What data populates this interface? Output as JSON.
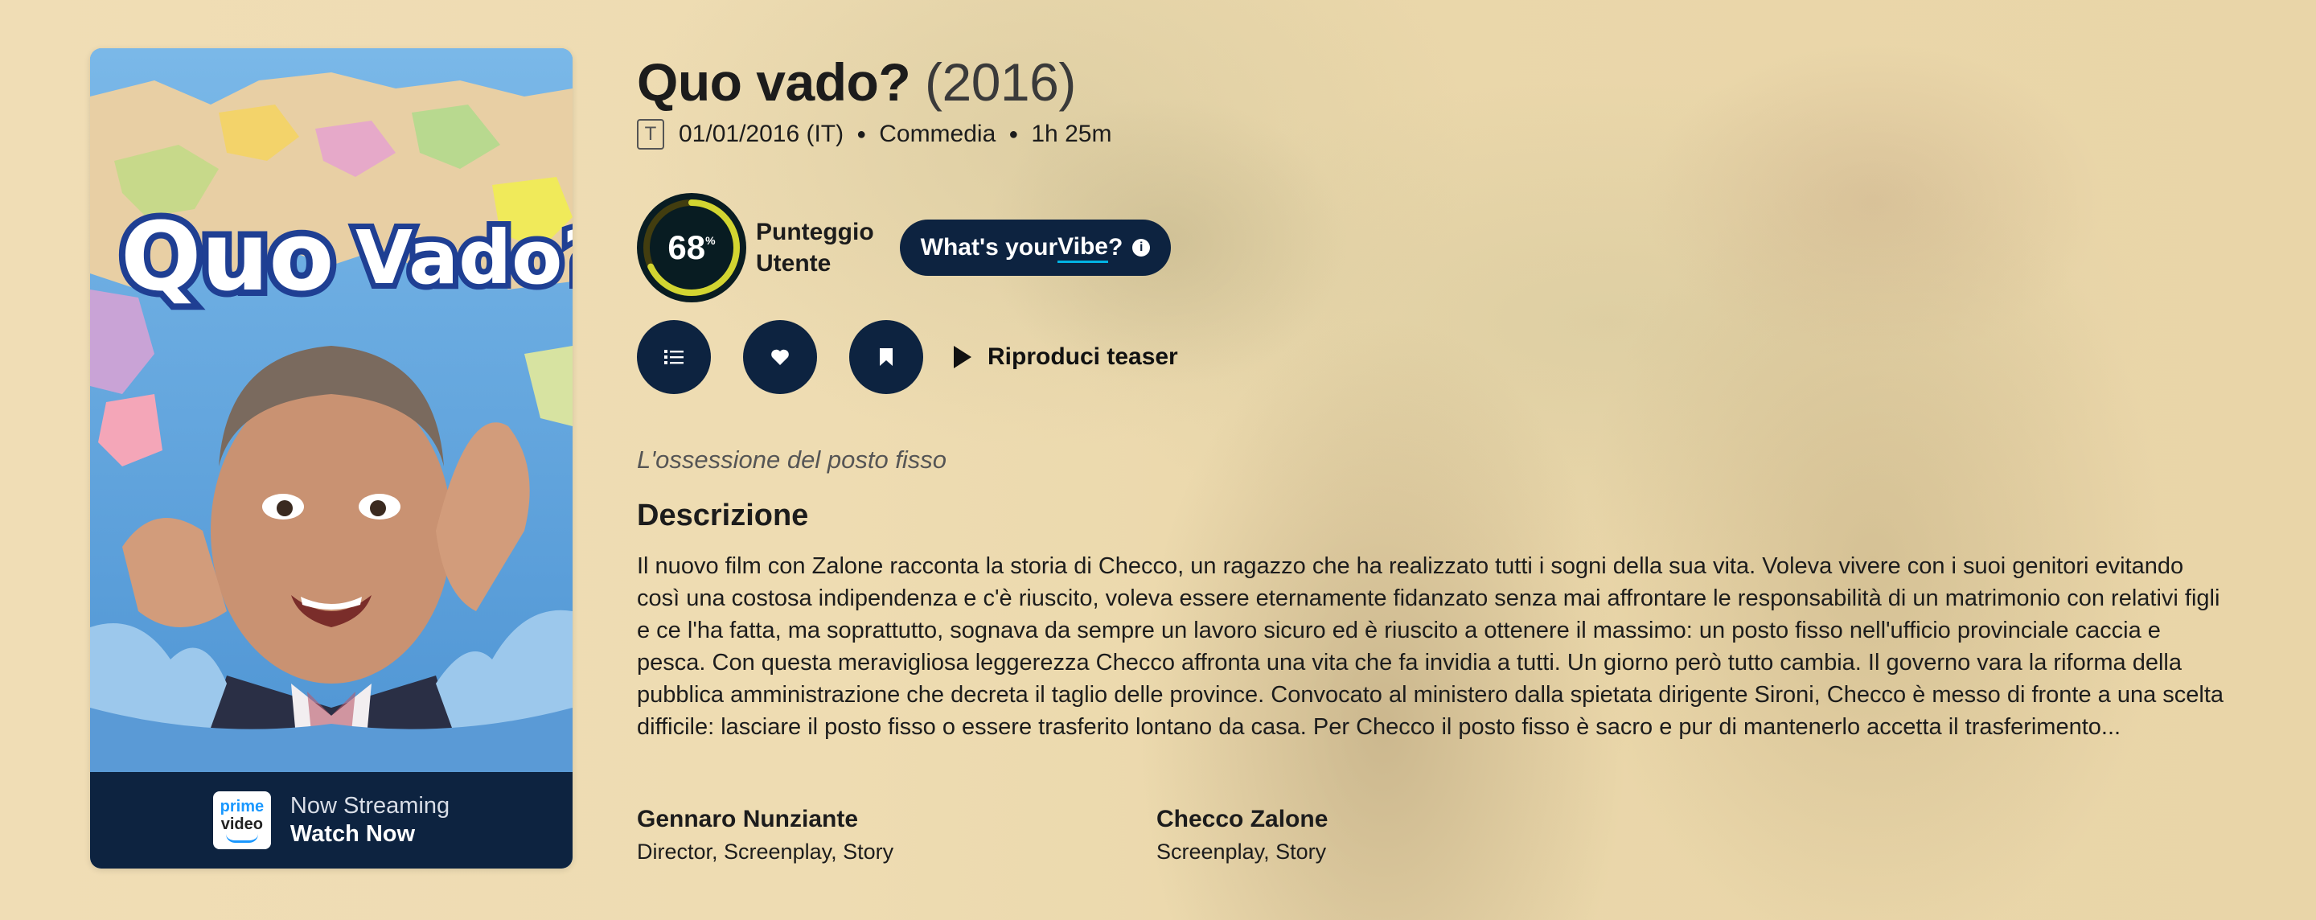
{
  "poster": {
    "title_art": "Quo Vado?",
    "provider": {
      "logo_top": "prime",
      "logo_bottom": "video",
      "line1": "Now Streaming",
      "line2": "Watch Now"
    }
  },
  "header": {
    "title": "Quo vado?",
    "year": "(2016)"
  },
  "facts": {
    "certification": "T",
    "release": "01/01/2016 (IT)",
    "genre": "Commedia",
    "runtime": "1h 25m"
  },
  "score": {
    "value": 68,
    "display": "68",
    "unit": "%",
    "label_line1": "Punteggio",
    "label_line2": "Utente",
    "ring_color": "#d2d531"
  },
  "vibe": {
    "text_before": "What's your ",
    "text_link": "Vibe",
    "text_after": "?",
    "icon": "info-icon"
  },
  "actions": {
    "list_icon": "list-icon",
    "favorite_icon": "heart-icon",
    "watchlist_icon": "bookmark-icon",
    "teaser_label": "Riproduci teaser"
  },
  "tagline": "L'ossessione del posto fisso",
  "description": {
    "heading": "Descrizione",
    "text": "Il nuovo film con Zalone racconta la storia di Checco, un ragazzo che ha realizzato tutti i sogni della sua vita. Voleva vivere con i suoi genitori evitando così una costosa indipendenza e c'è riuscito, voleva essere eternamente fidanzato senza mai affrontare le responsabilità di un matrimonio con relativi figli e ce l'ha fatta, ma soprattutto, sognava da sempre un lavoro sicuro ed è riuscito a ottenere il massimo: un posto fisso nell'ufficio provinciale caccia e pesca. Con questa meravigliosa leggerezza Checco affronta una vita che fa invidia a tutti. Un giorno però tutto cambia. Il governo vara la riforma della pubblica amministrazione che decreta il taglio delle province. Convocato al ministero dalla spietata dirigente Sironi, Checco è messo di fronte a una scelta difficile: lasciare il posto fisso o essere trasferito lontano da casa. Per Checco il posto fisso è sacro e pur di mantenerlo accetta il trasferimento..."
  },
  "crew": [
    {
      "name": "Gennaro Nunziante",
      "job": "Director, Screenplay, Story"
    },
    {
      "name": "Checco Zalone",
      "job": "Screenplay, Story"
    }
  ],
  "colors": {
    "navy": "#0d2340",
    "backdrop": "#efdcb3"
  }
}
